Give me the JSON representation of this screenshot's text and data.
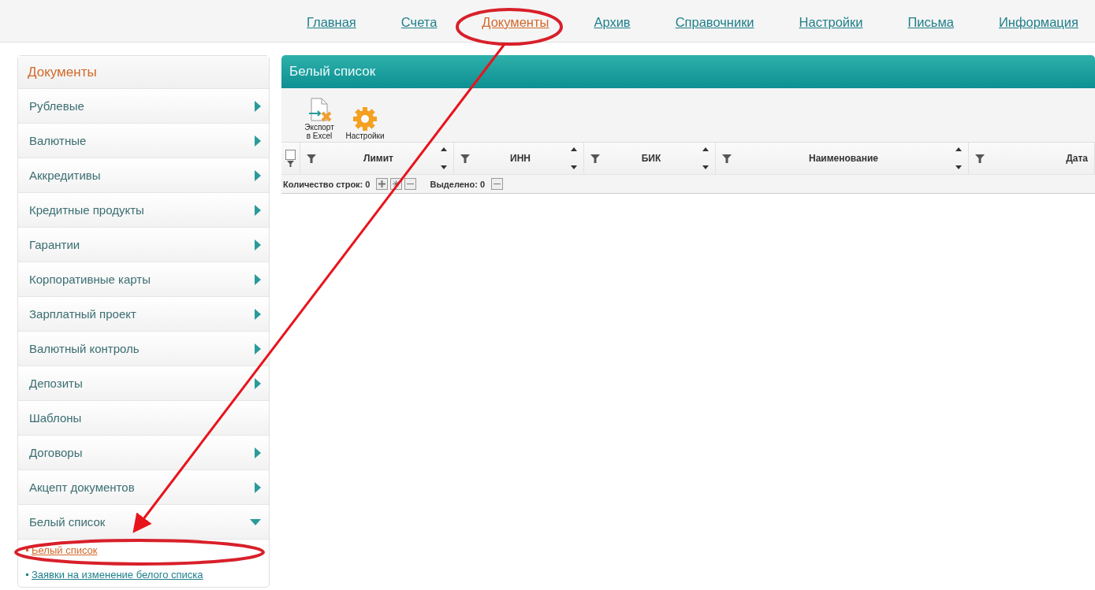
{
  "nav": [
    {
      "label": "Главная",
      "selected": false
    },
    {
      "label": "Счета",
      "selected": false
    },
    {
      "label": "Документы",
      "selected": true
    },
    {
      "label": "Архив",
      "selected": false
    },
    {
      "label": "Справочники",
      "selected": false
    },
    {
      "label": "Настройки",
      "selected": false
    },
    {
      "label": "Письма",
      "selected": false
    },
    {
      "label": "Информация",
      "selected": false
    }
  ],
  "sidebar": {
    "title": "Документы",
    "items": [
      {
        "label": "Рублевые",
        "kind": "folder",
        "expanded": false
      },
      {
        "label": "Валютные",
        "kind": "folder",
        "expanded": false
      },
      {
        "label": "Аккредитивы",
        "kind": "folder",
        "expanded": false
      },
      {
        "label": "Кредитные продукты",
        "kind": "folder",
        "expanded": false
      },
      {
        "label": "Гарантии",
        "kind": "folder",
        "expanded": false
      },
      {
        "label": "Корпоративные карты",
        "kind": "folder",
        "expanded": false
      },
      {
        "label": "Зарплатный проект",
        "kind": "folder",
        "expanded": false
      },
      {
        "label": "Валютный контроль",
        "kind": "folder",
        "expanded": false
      },
      {
        "label": "Депозиты",
        "kind": "folder",
        "expanded": false
      },
      {
        "label": "Шаблоны",
        "kind": "link"
      },
      {
        "label": "Договоры",
        "kind": "folder",
        "expanded": false
      },
      {
        "label": "Акцепт документов",
        "kind": "folder",
        "expanded": false
      },
      {
        "label": "Белый список",
        "kind": "folder",
        "expanded": true,
        "children": [
          {
            "label": "Белый список",
            "selected": true
          },
          {
            "label": "Заявки на изменение белого списка",
            "selected": false
          }
        ]
      }
    ]
  },
  "panel": {
    "title": "Белый список",
    "toolbar": [
      {
        "label": "Экспорт в Excel",
        "kind": "export"
      },
      {
        "label": "Настройки",
        "kind": "settings"
      }
    ],
    "columns": [
      "Лимит",
      "ИНН",
      "БИК",
      "Наименование",
      "Дата"
    ],
    "select_all": {
      "checked": false
    },
    "status": {
      "rows_label": "Количество строк: 0",
      "selected_label": "Выделено: 0"
    }
  }
}
